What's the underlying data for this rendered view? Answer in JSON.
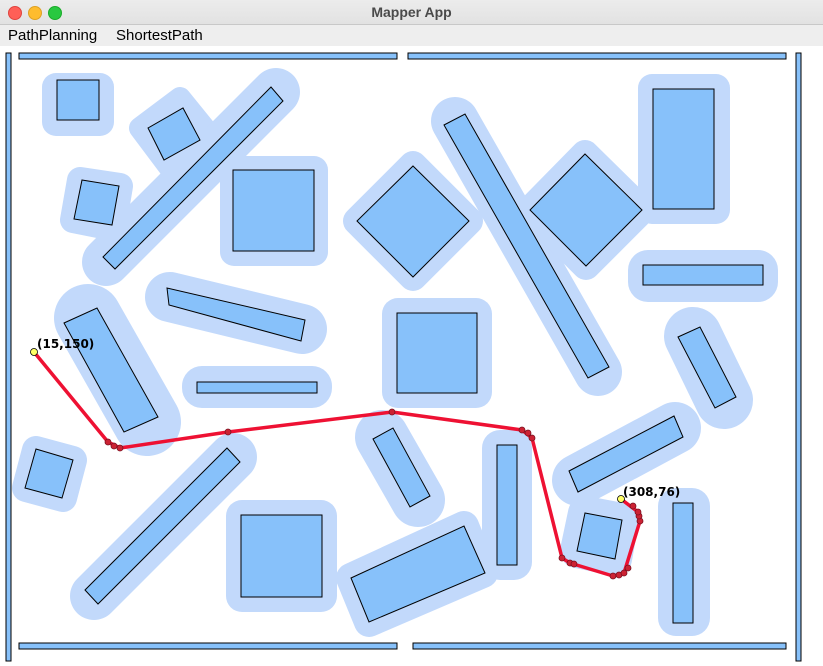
{
  "window": {
    "title": "Mapper App"
  },
  "menu": {
    "items": [
      "PathPlanning",
      "ShortestPath"
    ]
  },
  "map": {
    "colors": {
      "obstacle_fill": "#87c1fa",
      "buffer_fill": "#c2d9fb",
      "path": "#ee1133",
      "node": "#cc2233",
      "endpoint": "#ffff66"
    },
    "start_label": "(15,150)",
    "goal_label": "(308,76)"
  }
}
